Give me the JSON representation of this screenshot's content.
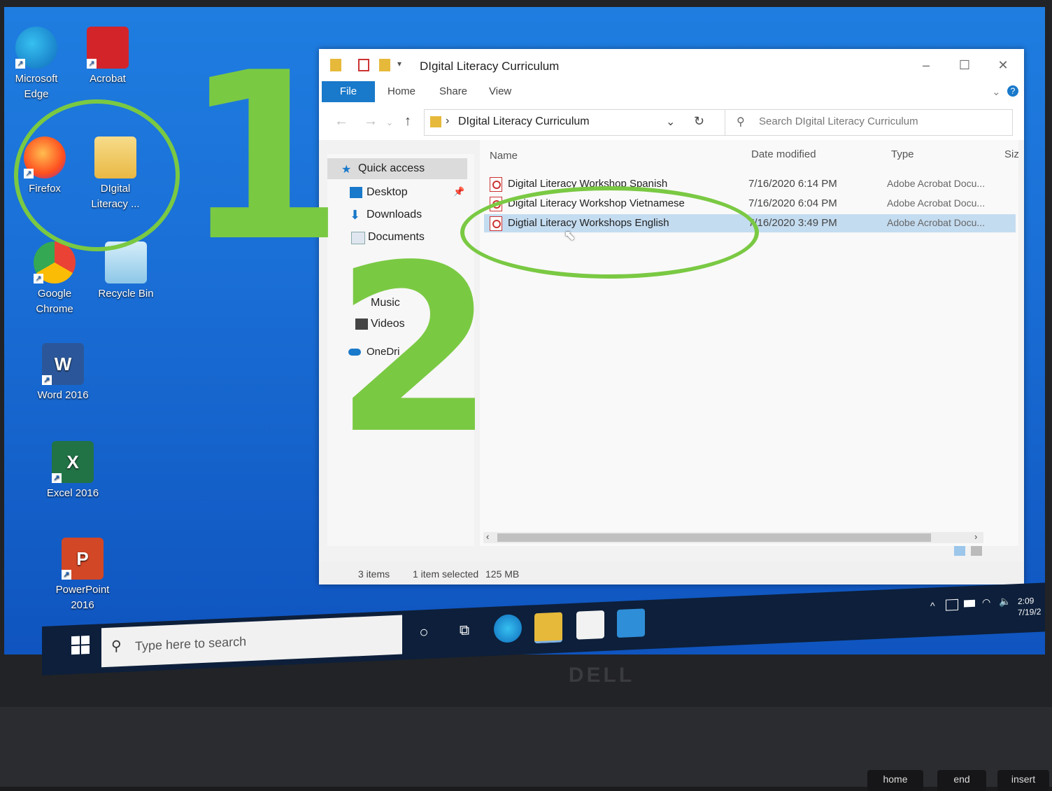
{
  "desktop": {
    "icons": [
      {
        "label": "Microsoft Edge",
        "label2": "",
        "color": "#1b9de2"
      },
      {
        "label": "Acrobat",
        "label2": "",
        "color": "#d3242a"
      },
      {
        "label": "Firefox",
        "label2": "",
        "color": "#ff7a1a"
      },
      {
        "label": "DIgital",
        "label2": "Literacy ...",
        "color": "#f2c84b"
      },
      {
        "label": "Google",
        "label2": "Chrome",
        "color": "#34a853"
      },
      {
        "label": "Recycle Bin",
        "label2": "",
        "color": "#9fd3f0"
      },
      {
        "label": "Word 2016",
        "label2": "",
        "color": "#2b579a"
      },
      {
        "label": "Excel 2016",
        "label2": "",
        "color": "#217346"
      },
      {
        "label": "PowerPoint",
        "label2": "2016",
        "color": "#d24726"
      }
    ]
  },
  "annotations": {
    "step1": "1",
    "step2": "2",
    "accent": "#7ac943"
  },
  "explorer": {
    "title": "DIgital Literacy Curriculum",
    "ribbon": {
      "file": "File",
      "home": "Home",
      "share": "Share",
      "view": "View"
    },
    "address": "DIgital Literacy Curriculum",
    "search_placeholder": "Search DIgital Literacy Curriculum",
    "nav": [
      {
        "label": "Quick access"
      },
      {
        "label": "Desktop"
      },
      {
        "label": "Downloads"
      },
      {
        "label": "Documents"
      },
      {
        "label": "Music"
      },
      {
        "label": "Videos"
      },
      {
        "label": "OneDri"
      }
    ],
    "columns": {
      "name": "Name",
      "date": "Date modified",
      "type": "Type",
      "size": "Siz"
    },
    "files": [
      {
        "name": "Digital Literacy Workshop Spanish",
        "date": "7/16/2020 6:14 PM",
        "type": "Adobe Acrobat Docu..."
      },
      {
        "name": "Digital Literacy Workshop Vietnamese",
        "date": "7/16/2020 6:04 PM",
        "type": "Adobe Acrobat Docu..."
      },
      {
        "name": "Digtial Literacy Workshops English",
        "date": "7/16/2020 3:49 PM",
        "type": "Adobe Acrobat Docu..."
      }
    ],
    "status": {
      "items": "3 items",
      "selected": "1 item selected",
      "size": "125 MB"
    }
  },
  "taskbar": {
    "search_placeholder": "Type here to search",
    "time": "2:09",
    "date": "7/19/2"
  },
  "keyboard": {
    "home": "home",
    "end": "end",
    "insert": "insert"
  },
  "brand": "DELL"
}
